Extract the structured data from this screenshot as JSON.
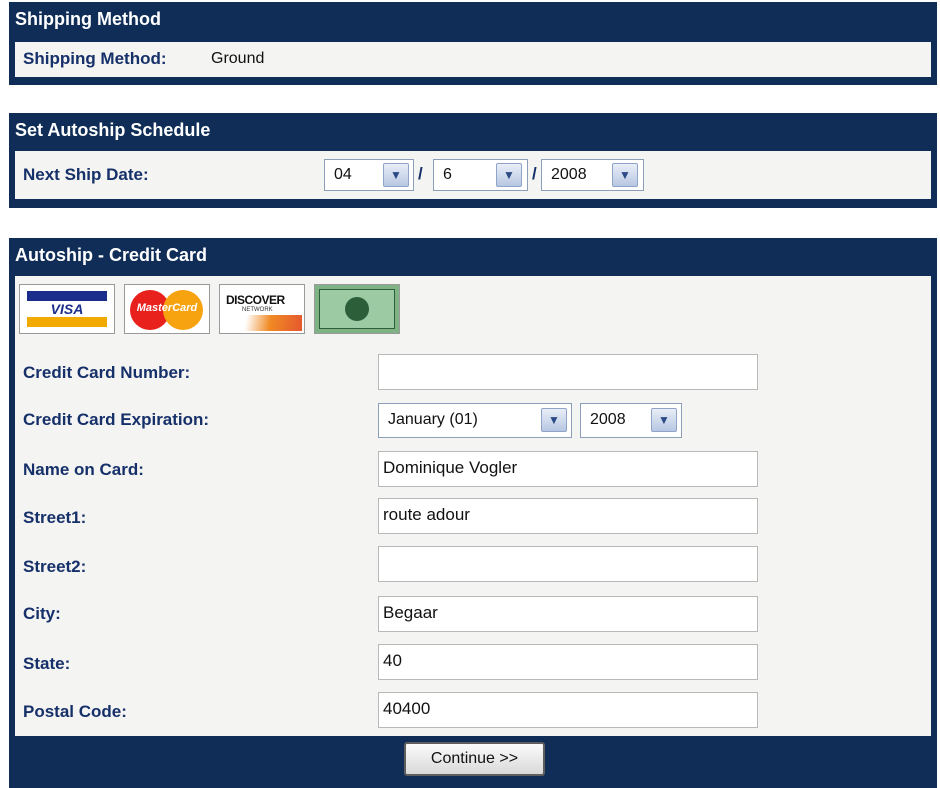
{
  "shipping": {
    "title": "Shipping Method",
    "label": "Shipping Method:",
    "value": "Ground"
  },
  "autoship": {
    "title": "Set Autoship Schedule",
    "next_ship_label": "Next Ship Date:",
    "month": "04",
    "day": "6",
    "year": "2008",
    "separator": "/"
  },
  "credit_card": {
    "title": "Autoship - Credit Card",
    "cards": [
      "visa-logo",
      "mastercard-logo",
      "discover-logo",
      "american-express-logo"
    ],
    "card_text": {
      "visa": "VISA",
      "mastercard": "MasterCard",
      "discover": "DISCOVER",
      "discover_sub": "NETWORK"
    },
    "fields": {
      "number_label": "Credit Card Number:",
      "number_value": "",
      "expiration_label": "Credit Card Expiration:",
      "exp_month": "January (01)",
      "exp_year": "2008",
      "name_label": "Name on Card:",
      "name_value": "Dominique Vogler",
      "street1_label": "Street1:",
      "street1_value": "route adour",
      "street2_label": "Street2:",
      "street2_value": "",
      "city_label": "City:",
      "city_value": "Begaar",
      "state_label": "State:",
      "state_value": "40",
      "postal_label": "Postal Code:",
      "postal_value": "40400"
    },
    "continue_label": "Continue >>"
  },
  "colors": {
    "panel": "#0f2d57",
    "label": "#16306a",
    "body": "#f4f4f2"
  }
}
